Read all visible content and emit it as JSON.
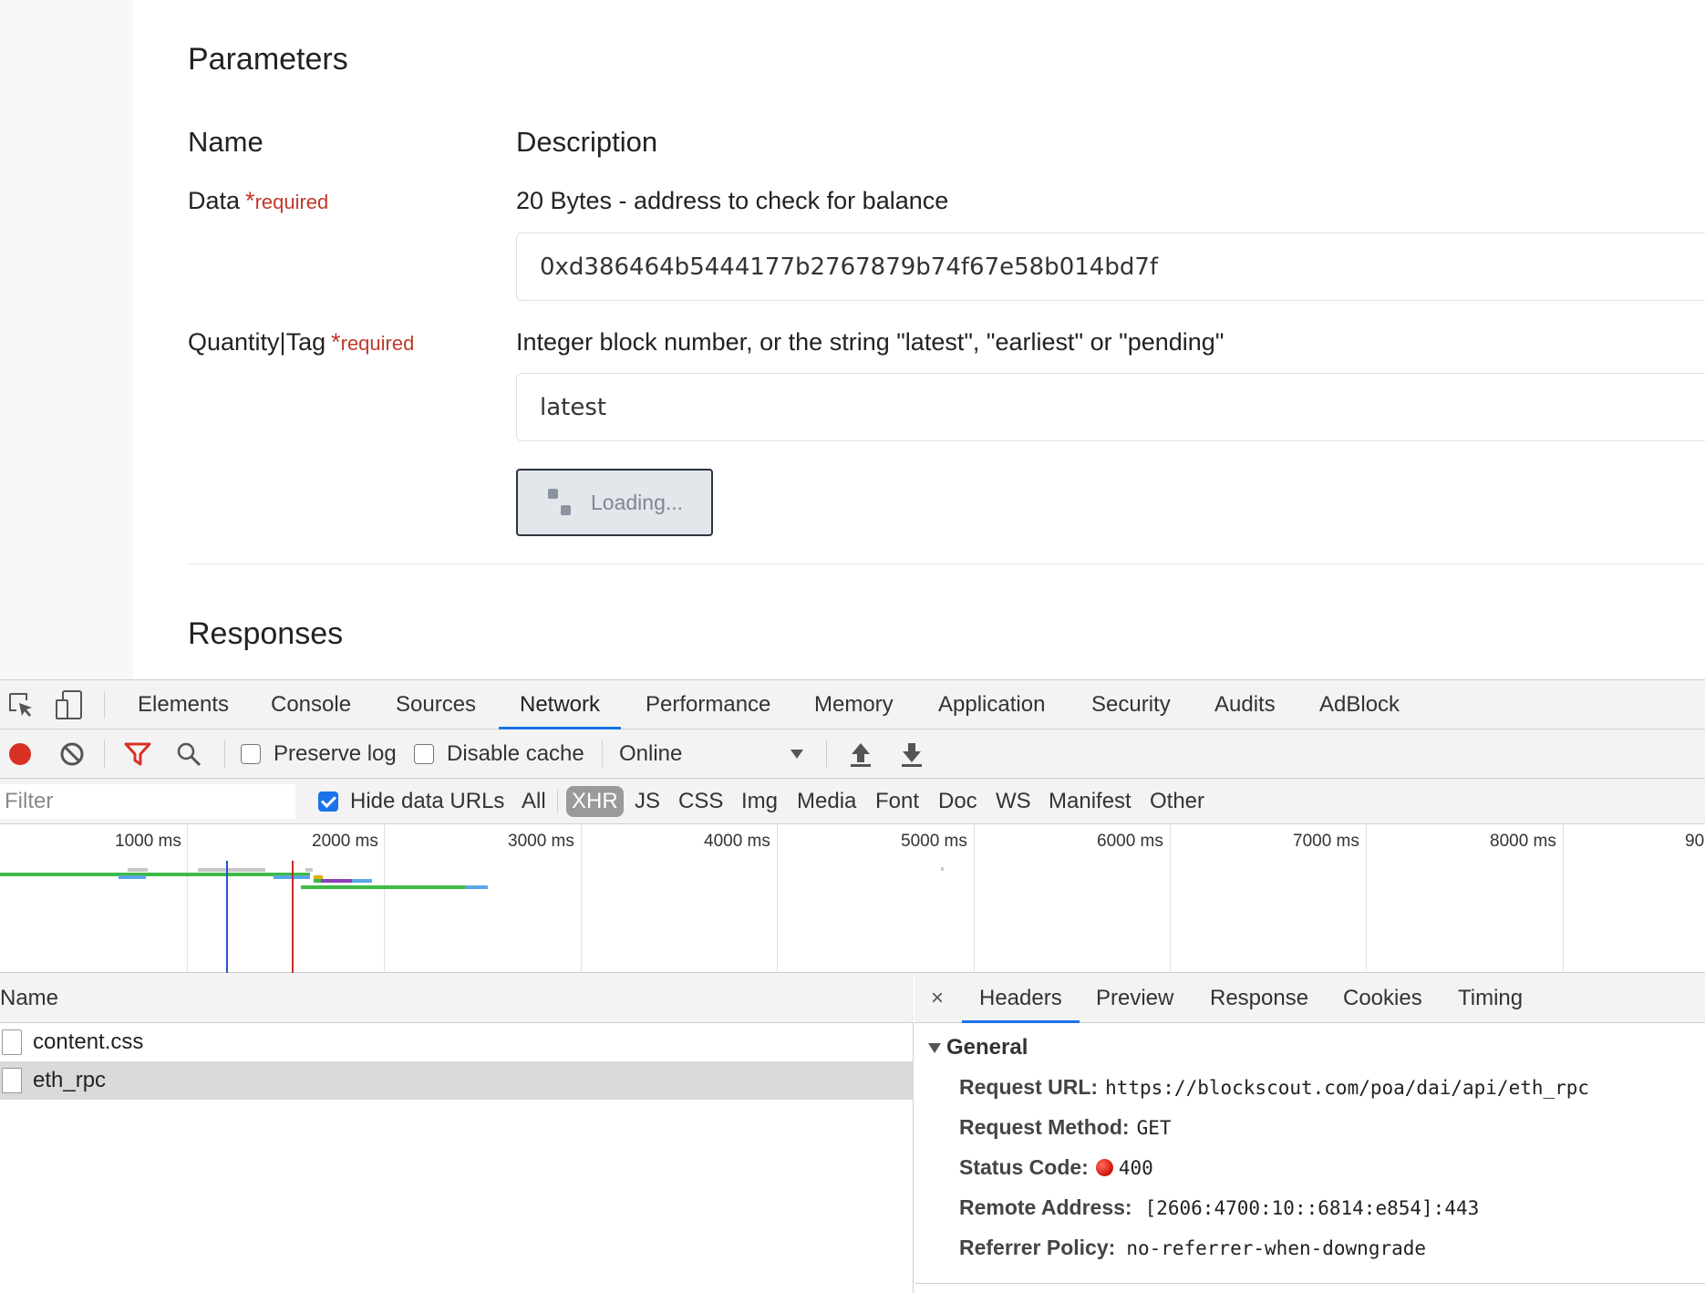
{
  "doc": {
    "parameters_heading": "Parameters",
    "name_col": "Name",
    "description_col": "Description",
    "params": [
      {
        "name": "Data",
        "star": "*",
        "required": "required",
        "description": "20 Bytes - address to check for balance",
        "value": "0xd386464b5444177b2767879b74f67e58b014bd7f"
      },
      {
        "name": "Quantity|Tag",
        "star": "*",
        "required": "required",
        "description": "Integer block number, or the string \"latest\", \"earliest\" or \"pending\"",
        "value": "latest"
      }
    ],
    "loading_label": "Loading...",
    "responses_heading": "Responses"
  },
  "devtools": {
    "tabs": [
      "Elements",
      "Console",
      "Sources",
      "Network",
      "Performance",
      "Memory",
      "Application",
      "Security",
      "Audits",
      "AdBlock"
    ],
    "active_tab": "Network",
    "toolbar": {
      "preserve_log": "Preserve log",
      "preserve_log_checked": false,
      "disable_cache": "Disable cache",
      "disable_cache_checked": false,
      "throttling": "Online"
    },
    "filterbar": {
      "filter_placeholder": "Filter",
      "hide_data_urls": "Hide data URLs",
      "hide_data_urls_checked": true,
      "types": [
        "All",
        "XHR",
        "JS",
        "CSS",
        "Img",
        "Media",
        "Font",
        "Doc",
        "WS",
        "Manifest",
        "Other"
      ],
      "active_type": "XHR"
    },
    "timeline": {
      "ticks": [
        "1000 ms",
        "2000 ms",
        "3000 ms",
        "4000 ms",
        "5000 ms",
        "6000 ms",
        "7000 ms",
        "8000 ms",
        "90"
      ]
    },
    "list": {
      "header": "Name",
      "rows": [
        {
          "name": "content.css",
          "selected": false
        },
        {
          "name": "eth_rpc",
          "selected": true
        }
      ]
    },
    "details": {
      "close": "×",
      "tabs": [
        "Headers",
        "Preview",
        "Response",
        "Cookies",
        "Timing"
      ],
      "active_tab": "Headers",
      "general_title": "General",
      "general": {
        "request_url_key": "Request URL:",
        "request_url": "https://blockscout.com/poa/dai/api/eth_rpc",
        "request_method_key": "Request Method:",
        "request_method": "GET",
        "status_code_key": "Status Code:",
        "status_code": "400",
        "remote_address_key": "Remote Address:",
        "remote_address": "[2606:4700:10::6814:e854]:443",
        "referrer_policy_key": "Referrer Policy:",
        "referrer_policy": "no-referrer-when-downgrade"
      }
    }
  },
  "colors": {
    "accent": "#1a73e8",
    "required": "#c0392b",
    "record": "#d93025",
    "status_error": "#d0140a"
  }
}
